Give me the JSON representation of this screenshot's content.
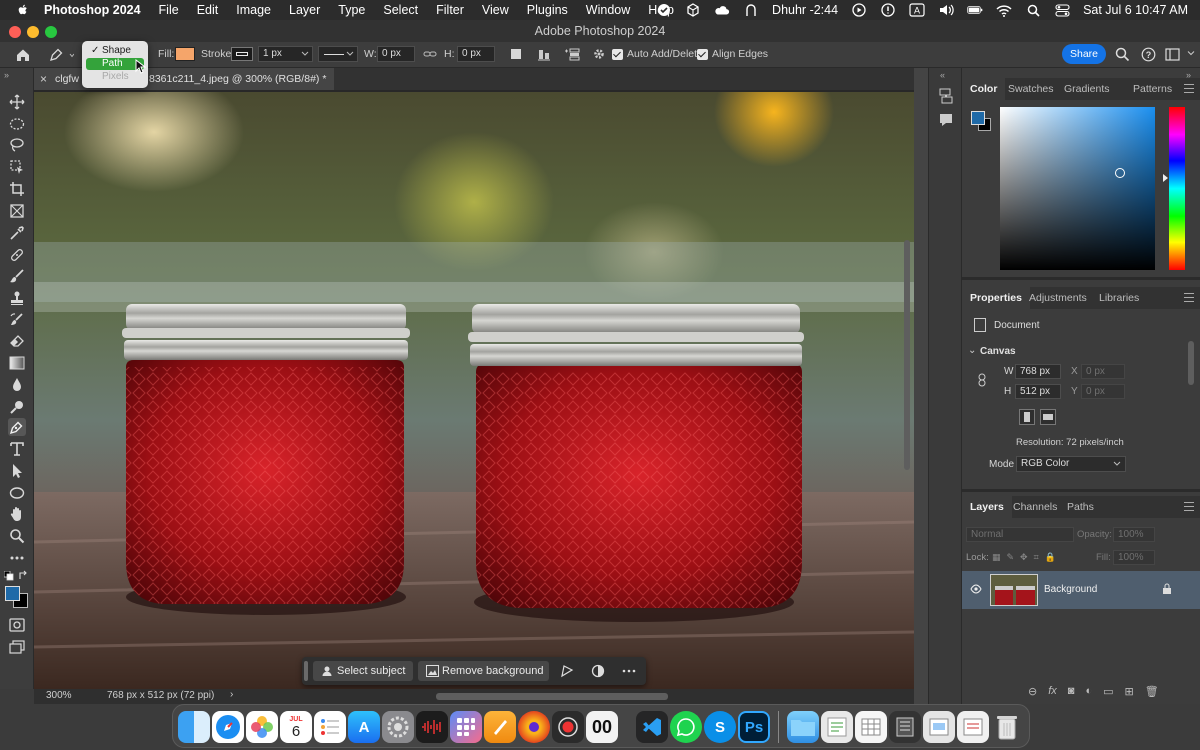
{
  "menubar": {
    "app_name": "Photoshop 2024",
    "items": [
      "File",
      "Edit",
      "Image",
      "Layer",
      "Type",
      "Select",
      "Filter",
      "View",
      "Plugins",
      "Window",
      "Help"
    ],
    "prayer": "Dhuhr -2:44",
    "date_time": "Sat Jul 6  10:47 AM"
  },
  "window": {
    "title": "Adobe Photoshop 2024"
  },
  "options": {
    "mode_menu": {
      "shape": "Shape",
      "path": "Path",
      "pixels": "Pixels"
    },
    "fill_label": "Fill:",
    "fill_color": "#f5a56a",
    "stroke_label": "Stroke:",
    "stroke_width": "1 px",
    "w_label": "W:",
    "w_value": "0 px",
    "h_label": "H:",
    "h_value": "0 px",
    "auto_add_delete": "Auto Add/Delete",
    "align_edges": "Align Edges",
    "share": "Share"
  },
  "document": {
    "tab_prefix": "clgfw",
    "tab_suffix": "8361c211_4.jpeg @ 300% (RGB/8#) *",
    "zoom": "300%",
    "info": "768 px x 512 px (72 ppi)"
  },
  "taskbar": {
    "select_subject": "Select subject",
    "remove_background": "Remove background"
  },
  "color_panel": {
    "tabs": [
      "Color",
      "Swatches",
      "Gradients",
      "Patterns"
    ],
    "foreground": "#1f6aa8",
    "background": "#000000"
  },
  "properties_panel": {
    "tabs": [
      "Properties",
      "Adjustments",
      "Libraries"
    ],
    "document_label": "Document",
    "canvas_label": "Canvas",
    "w_label": "W",
    "w_value": "768 px",
    "h_label": "H",
    "h_value": "512 px",
    "x_label": "X",
    "x_value": "0 px",
    "y_label": "Y",
    "y_value": "0 px",
    "resolution": "Resolution: 72 pixels/inch",
    "mode_label": "Mode",
    "mode_value": "RGB Color"
  },
  "layers_panel": {
    "tabs": [
      "Layers",
      "Channels",
      "Paths"
    ],
    "blend_mode": "Normal",
    "opacity_label": "Opacity:",
    "opacity_value": "100%",
    "lock_label": "Lock:",
    "fill_label": "Fill:",
    "fill_value": "100%",
    "layer_name": "Background"
  },
  "dock": {
    "calendar_month": "JUL",
    "calendar_day": "6",
    "ps_label": "Ps"
  }
}
